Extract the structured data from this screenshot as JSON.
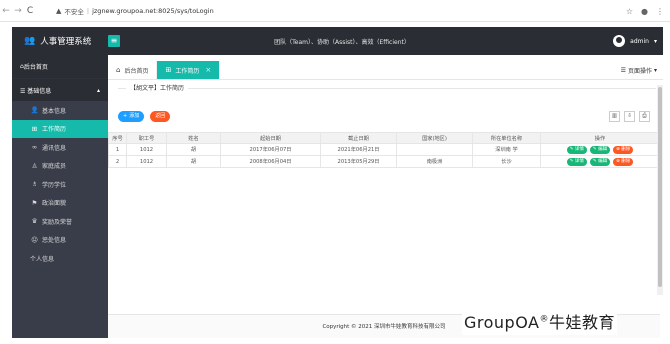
{
  "browser": {
    "security_label": "不安全",
    "url": "jzgnew.groupoa.net:8025/sys/toLogin"
  },
  "header": {
    "brand": "人事管理系统",
    "slogan": "团队（Team）、协助（Assist）、高效（Efficient）",
    "username": "admin"
  },
  "sidebar": {
    "home": "后台首页",
    "group": "基础信息",
    "items": [
      {
        "label": "基本信息",
        "icon": "user-icon"
      },
      {
        "label": "工作简历",
        "icon": "briefcase-icon",
        "active": true
      },
      {
        "label": "通讯信息",
        "icon": "contact-icon"
      },
      {
        "label": "家庭成员",
        "icon": "family-icon"
      },
      {
        "label": "学历学位",
        "icon": "education-icon"
      },
      {
        "label": "政治面貌",
        "icon": "political-icon"
      },
      {
        "label": "奖励及荣誉",
        "icon": "award-icon"
      },
      {
        "label": "惩处信息",
        "icon": "penalty-icon"
      },
      {
        "label": "个人信息",
        "icon": ""
      }
    ]
  },
  "tabs": {
    "home": "后台首页",
    "current": "工作简历",
    "page_ops": "页面操作"
  },
  "content": {
    "title": "【胡文平】工作简历",
    "add_label": "添加",
    "back_label": "返回",
    "columns": [
      "序号",
      "职工号",
      "姓名",
      "起始日期",
      "截止日期",
      "国家(地区)",
      "所在单位名称",
      "操作"
    ],
    "rows": [
      [
        "1",
        "1012",
        "胡",
        "2017年06月07日",
        "2021年06月21日",
        "",
        "深圳南 学"
      ],
      [
        "2",
        "1012",
        "胡",
        "2008年06月04日",
        "2013年05月29日",
        "南极洲",
        "长沙"
      ]
    ],
    "action_labels": {
      "detail": "详情",
      "edit": "编辑",
      "delete": "删除"
    }
  },
  "footer": {
    "copyright": "Copyright © 2021 深圳市牛娃教育科技有限公司"
  },
  "watermark": {
    "brand": "GroupOA",
    "mark": "®",
    "suffix": "牛娃教育"
  },
  "colors": {
    "accent": "#16baaa",
    "header_bg": "#2a2d33",
    "sidebar_bg": "#393d49",
    "blue": "#1e9fff",
    "orange": "#ff5722",
    "green": "#16b777"
  }
}
